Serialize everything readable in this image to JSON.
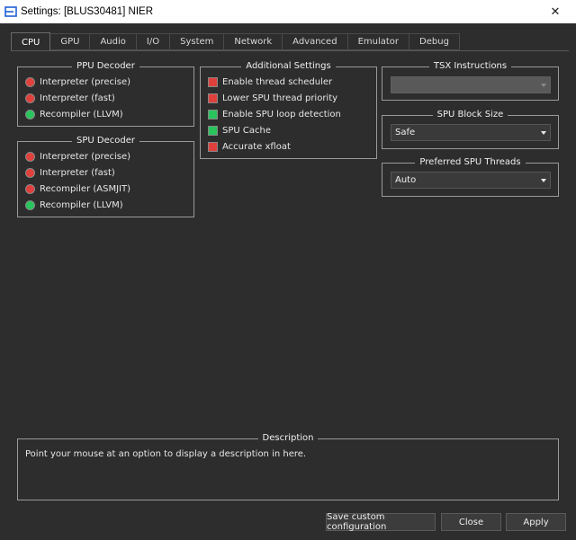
{
  "window": {
    "title": "Settings: [BLUS30481] NIER",
    "close_glyph": "✕",
    "logo_icon": "rpcs3-logo-icon"
  },
  "tabs": [
    {
      "label": "CPU",
      "active": true
    },
    {
      "label": "GPU",
      "active": false
    },
    {
      "label": "Audio",
      "active": false
    },
    {
      "label": "I/O",
      "active": false
    },
    {
      "label": "System",
      "active": false
    },
    {
      "label": "Network",
      "active": false
    },
    {
      "label": "Advanced",
      "active": false
    },
    {
      "label": "Emulator",
      "active": false
    },
    {
      "label": "Debug",
      "active": false
    }
  ],
  "ppu_decoder": {
    "title": "PPU Decoder",
    "options": [
      {
        "label": "Interpreter (precise)",
        "selected": false
      },
      {
        "label": "Interpreter (fast)",
        "selected": false
      },
      {
        "label": "Recompiler (LLVM)",
        "selected": true
      }
    ]
  },
  "spu_decoder": {
    "title": "SPU Decoder",
    "options": [
      {
        "label": "Interpreter (precise)",
        "selected": false
      },
      {
        "label": "Interpreter (fast)",
        "selected": false
      },
      {
        "label": "Recompiler (ASMJIT)",
        "selected": false
      },
      {
        "label": "Recompiler (LLVM)",
        "selected": true
      }
    ]
  },
  "additional_settings": {
    "title": "Additional Settings",
    "options": [
      {
        "label": "Enable thread scheduler",
        "checked": false
      },
      {
        "label": "Lower SPU thread priority",
        "checked": false
      },
      {
        "label": "Enable SPU loop detection",
        "checked": true
      },
      {
        "label": "SPU Cache",
        "checked": true
      },
      {
        "label": "Accurate xfloat",
        "checked": false
      }
    ]
  },
  "tsx_instructions": {
    "title": "TSX Instructions",
    "value": "",
    "enabled": false
  },
  "spu_block_size": {
    "title": "SPU Block Size",
    "value": "Safe"
  },
  "preferred_spu_threads": {
    "title": "Preferred SPU Threads",
    "value": "Auto"
  },
  "description": {
    "title": "Description",
    "text": "Point your mouse at an option to display a description in here."
  },
  "buttons": {
    "save_custom": "Save custom configuration",
    "close": "Close",
    "apply": "Apply"
  },
  "colors": {
    "enabled_indicator": "#29c45c",
    "disabled_indicator": "#e0413c",
    "background": "#2d2d2d"
  }
}
